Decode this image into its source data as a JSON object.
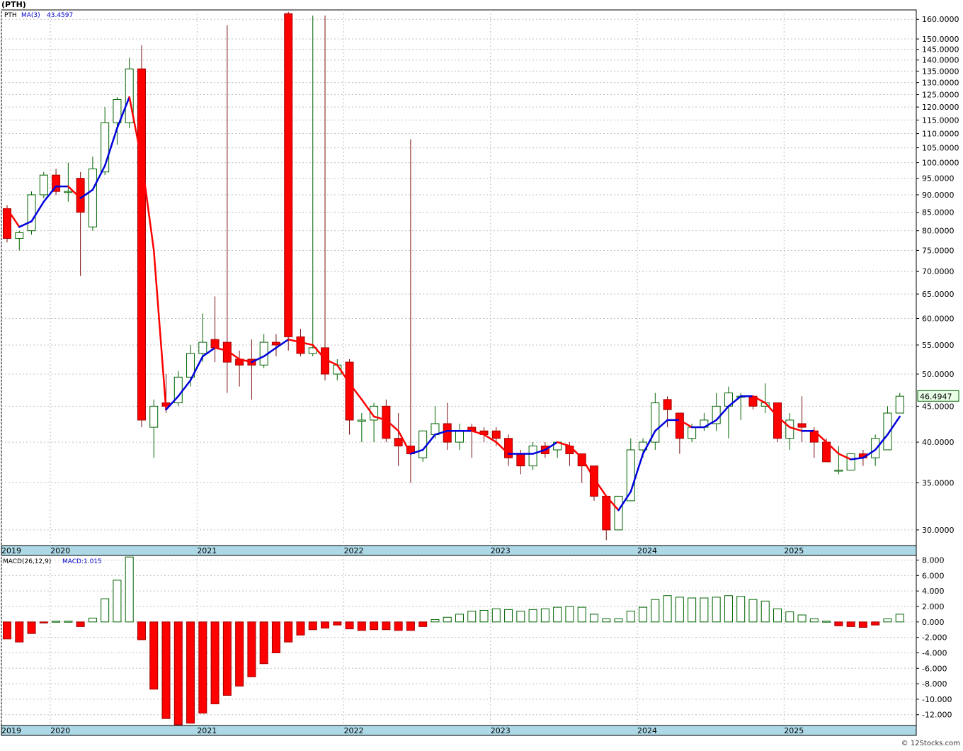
{
  "title": "(PTH)",
  "footer": "© 12Stocks.com",
  "colors": {
    "up": "#006400",
    "down": "#ff0000",
    "ma_up": "#0000dd",
    "ma_down": "#ff0000",
    "axis_strip": "#add8e6",
    "grid": "#c0c0c0"
  },
  "chart_data": [
    {
      "type": "candlestick",
      "ticker": "PTH",
      "ma_label": "MA(3)",
      "ma_value": "43.4597",
      "last_price_label": "46.4947",
      "y_axis_scale": "log",
      "ylim": [
        28.5,
        165
      ],
      "y_ticks": [
        "30.0000",
        "35.0000",
        "40.0000",
        "45.0000",
        "50.0000",
        "55.0000",
        "60.0000",
        "65.0000",
        "70.0000",
        "75.0000",
        "80.0000",
        "85.0000",
        "90.0000",
        "95.0000",
        "100.0000",
        "105.0000",
        "110.0000",
        "115.0000",
        "120.0000",
        "125.0000",
        "130.0000",
        "135.0000",
        "140.0000",
        "145.0000",
        "150.0000",
        "160.0000"
      ],
      "year_labels": [
        {
          "label": "2019",
          "index": 0
        },
        {
          "label": "2020",
          "index": 4
        },
        {
          "label": "2021",
          "index": 16
        },
        {
          "label": "2022",
          "index": 28
        },
        {
          "label": "2023",
          "index": 40
        },
        {
          "label": "2024",
          "index": 52
        },
        {
          "label": "2025",
          "index": 64
        }
      ],
      "candles": [
        [
          86,
          87,
          77,
          78
        ],
        [
          78,
          80,
          75,
          79.5
        ],
        [
          80,
          91,
          79,
          90
        ],
        [
          90,
          97,
          89,
          96
        ],
        [
          96,
          98,
          90,
          91
        ],
        [
          91,
          100,
          88,
          91
        ],
        [
          95,
          97,
          69,
          85
        ],
        [
          81,
          102,
          80,
          98
        ],
        [
          97,
          120,
          96,
          114
        ],
        [
          114,
          124,
          106,
          123
        ],
        [
          114,
          141,
          112,
          136
        ],
        [
          136,
          147,
          42,
          43
        ],
        [
          42,
          46,
          38,
          45
        ],
        [
          45.5,
          50,
          44,
          45
        ],
        [
          45.5,
          50.5,
          45,
          49.5
        ],
        [
          49.5,
          55,
          48,
          53.5
        ],
        [
          53.5,
          61,
          52,
          55.5
        ],
        [
          56,
          64.5,
          52,
          54.5
        ],
        [
          55.5,
          157,
          47,
          52
        ],
        [
          52.5,
          54,
          48,
          51.5
        ],
        [
          52.5,
          56,
          46,
          51.5
        ],
        [
          51.5,
          57,
          51,
          55.5
        ],
        [
          55.5,
          57,
          53,
          55
        ],
        [
          163,
          164,
          54,
          56.5
        ],
        [
          56.5,
          58,
          53,
          53.5
        ],
        [
          53.5,
          162,
          53,
          54.5
        ],
        [
          54.5,
          162,
          49,
          50
        ],
        [
          50,
          52.5,
          49,
          51.5
        ],
        [
          52,
          52.5,
          41,
          43
        ],
        [
          43,
          44,
          40,
          43
        ],
        [
          43,
          45.5,
          40,
          45
        ],
        [
          45,
          46,
          40,
          40.5
        ],
        [
          40.5,
          44,
          37,
          39.5
        ],
        [
          39.5,
          108,
          35,
          38.5
        ],
        [
          38,
          41.5,
          37.5,
          41.5
        ],
        [
          41,
          45,
          40.5,
          42.5
        ],
        [
          42.5,
          45.5,
          39,
          40
        ],
        [
          40,
          42.5,
          39,
          41.5
        ],
        [
          42,
          42.5,
          38,
          41.5
        ],
        [
          41.5,
          42,
          40,
          41
        ]
      ],
      "candles_cont": [
        [
          41.5,
          42,
          39.5,
          40.5
        ],
        [
          40.5,
          41,
          37,
          38
        ],
        [
          38.5,
          39,
          36,
          37
        ],
        [
          37,
          40,
          36.5,
          39.5
        ],
        [
          39.5,
          40,
          38,
          38.5
        ],
        [
          39,
          40,
          38,
          40
        ],
        [
          39.5,
          40,
          37,
          38.5
        ],
        [
          38.5,
          38.5,
          35,
          37
        ],
        [
          37,
          37,
          33,
          33.5
        ],
        [
          33.5,
          33.5,
          29,
          30
        ],
        [
          30,
          33.5,
          30,
          33.5
        ],
        [
          33,
          40.5,
          33,
          39
        ],
        [
          39,
          40.5,
          38,
          40
        ],
        [
          40,
          47,
          39,
          45.5
        ],
        [
          46,
          46.5,
          42,
          44.5
        ],
        [
          44,
          44,
          38.5,
          40.5
        ],
        [
          40.5,
          42.5,
          40,
          42
        ],
        [
          42,
          44,
          41.5,
          43
        ],
        [
          42.5,
          47,
          41.5,
          45
        ],
        [
          45,
          48,
          40.5,
          47
        ],
        [
          46.5,
          47,
          43,
          46.5
        ],
        [
          46.5,
          46.5,
          44.5,
          45
        ],
        [
          45,
          48.5,
          44,
          45.5
        ],
        [
          45.5,
          45.5,
          40,
          40.5
        ],
        [
          40.5,
          44,
          39,
          43
        ],
        [
          42.5,
          46.5,
          40,
          42
        ],
        [
          41.5,
          42,
          38,
          40
        ],
        [
          40,
          40.5,
          37.5,
          37.5
        ],
        [
          36.5,
          39.5,
          36,
          36.5
        ],
        [
          36.5,
          38.5,
          36.5,
          38.5
        ],
        [
          38.5,
          39,
          37,
          38
        ],
        [
          38,
          41,
          37,
          40.5
        ],
        [
          39,
          45,
          39,
          44
        ],
        [
          44,
          47,
          44,
          46.5
        ]
      ],
      "ma3": [
        86,
        81,
        82.5,
        88,
        92.5,
        92.5,
        89,
        91.5,
        99,
        112,
        124,
        101,
        75,
        44.5,
        46.5,
        49,
        53,
        54.5,
        54,
        52.5,
        52,
        53,
        54.5,
        56,
        55.5,
        55,
        52.5,
        51.5,
        48.5,
        46,
        43.5,
        43,
        41.5,
        38.5,
        39,
        41,
        41.5,
        41.5,
        41.5,
        41,
        40,
        38.5,
        38.5,
        38.5,
        39,
        40,
        39.5,
        38,
        35.5,
        33.5,
        32,
        34,
        38.5,
        41.5,
        43,
        43,
        42,
        42,
        43,
        45,
        46.5,
        46.5,
        45.5,
        43.5,
        42,
        41.5,
        41.5,
        40,
        38.5,
        37.8,
        38,
        39,
        41,
        43.5
      ]
    },
    {
      "type": "bar",
      "label": "MACD(26,12,9)",
      "value_label": "MACD:1.015",
      "ylim": [
        -13.4,
        8.6
      ],
      "y_ticks": [
        "8.000",
        "6.000",
        "4.000",
        "2.000",
        "0.000",
        "-2.000",
        "-4.000",
        "-6.000",
        "-8.000",
        "-10.000",
        "-12.000"
      ],
      "values": [
        -2.2,
        -2.6,
        -1.5,
        -0.1,
        0.1,
        0.1,
        -0.6,
        0.5,
        3.0,
        5.4,
        8.4,
        -2.3,
        -8.7,
        -12.5,
        -13.3,
        -13.1,
        -11.8,
        -10.6,
        -9.5,
        -8.3,
        -7.1,
        -5.4,
        -4.0,
        -2.6,
        -1.7,
        -1.0,
        -0.8,
        -0.4,
        -0.9,
        -1.1,
        -1.0,
        -1.0,
        -1.1,
        -1.1,
        -0.6,
        0.3,
        0.6,
        1.0,
        1.4,
        1.5,
        1.7,
        1.6,
        1.4,
        1.6,
        1.7,
        1.9,
        2.0,
        1.9,
        1.0,
        0.4,
        0.4,
        1.4,
        1.9,
        2.9,
        3.4,
        3.2,
        3.1,
        3.1,
        3.2,
        3.4,
        3.3,
        2.9,
        2.7,
        1.7,
        1.3,
        0.9,
        0.4,
        0.1,
        -0.5,
        -0.6,
        -0.7,
        -0.4,
        0.4,
        1.0
      ]
    }
  ]
}
